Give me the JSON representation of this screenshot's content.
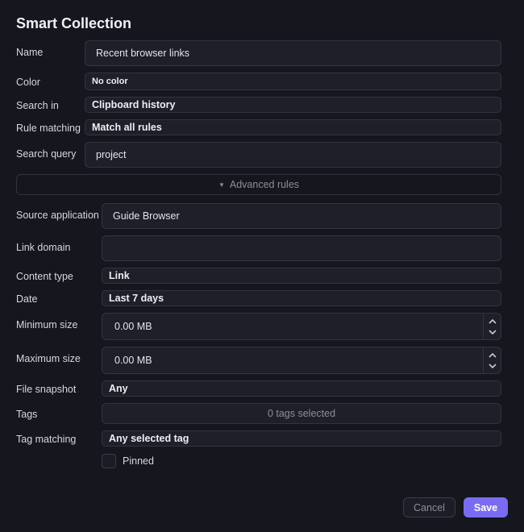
{
  "dialog": {
    "title": "Smart Collection"
  },
  "fields": {
    "name": {
      "label": "Name",
      "value": "Recent browser links"
    },
    "color": {
      "label": "Color",
      "value": "No color"
    },
    "search_in": {
      "label": "Search in",
      "value": "Clipboard history"
    },
    "rule_matching": {
      "label": "Rule matching",
      "value": "Match all rules"
    },
    "search_query": {
      "label": "Search query",
      "value": "project"
    }
  },
  "advanced": {
    "toggle_label": "Advanced rules",
    "source_application": {
      "label": "Source application",
      "value": "Guide Browser"
    },
    "link_domain": {
      "label": "Link domain",
      "value": ""
    },
    "content_type": {
      "label": "Content type",
      "value": "Link"
    },
    "date": {
      "label": "Date",
      "value": "Last 7 days"
    },
    "minimum_size": {
      "label": "Minimum size",
      "value": "0.00 MB"
    },
    "maximum_size": {
      "label": "Maximum size",
      "value": "0.00 MB"
    },
    "file_snapshot": {
      "label": "File snapshot",
      "value": "Any"
    },
    "tags": {
      "label": "Tags",
      "value": "0 tags selected"
    },
    "tag_matching": {
      "label": "Tag matching",
      "value": "Any selected tag"
    },
    "pinned": {
      "label": "Pinned",
      "checked": false
    }
  },
  "actions": {
    "cancel_label": "Cancel",
    "save_label": "Save"
  },
  "colors": {
    "background": "#15161e",
    "field_background": "#1e1f29",
    "border": "#33343f",
    "accent": "#7a6cf2"
  }
}
